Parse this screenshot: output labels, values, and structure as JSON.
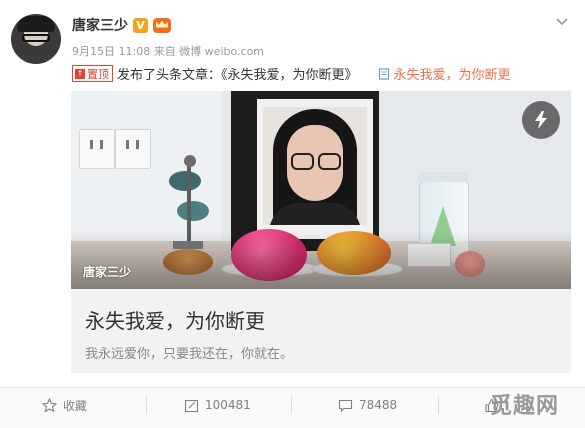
{
  "post": {
    "username": "唐家三少",
    "verified_mark": "V",
    "meta": "9月15日 11:08 来自 微博 weibo.com",
    "top_tag": "置顶",
    "published_text": "发布了头条文章：《永失我爱，为你断更》",
    "article_link": "永失我爱，为你断更"
  },
  "card": {
    "image_watermark": "唐家三少",
    "title": "永失我爱，为你断更",
    "subtitle": "我永远爱你，只要我还在，你就在。"
  },
  "actions": {
    "favorite": "收藏",
    "repost": "100481",
    "comment": "78488"
  },
  "site_watermark": "觅趣网",
  "colors": {
    "accent_link": "#eb7350",
    "tag_red": "#e0432f",
    "verified": "#f7a11a"
  },
  "icons": [
    "chevron-down-icon",
    "top-pin-icon",
    "article-icon",
    "flash-icon",
    "star-icon",
    "repost-icon",
    "comment-icon",
    "like-icon"
  ]
}
